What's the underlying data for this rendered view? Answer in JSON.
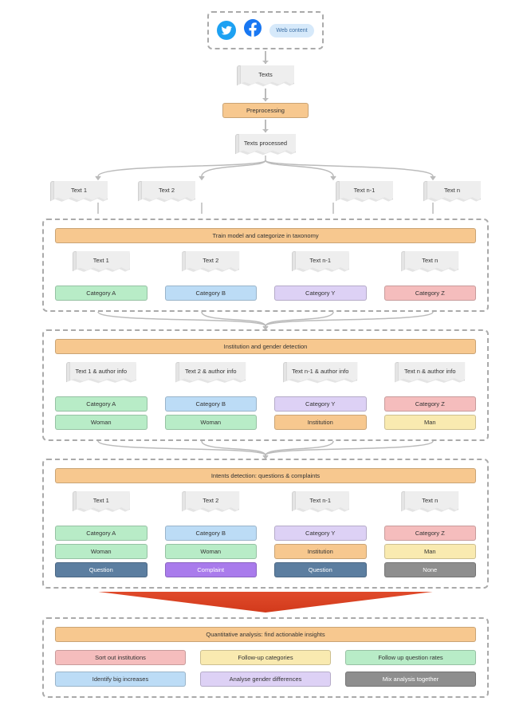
{
  "sources": {
    "twitter": "twitter-icon",
    "facebook": "facebook-icon",
    "web": "Web content"
  },
  "texts": {
    "label": "Texts",
    "processed": "Texts processed"
  },
  "preprocessing": "Preprocessing",
  "split": {
    "t1": "Text 1",
    "t2": "Text 2",
    "tn1": "Text n-1",
    "tn": "Text n"
  },
  "stage1": {
    "title": "Train model and categorize in taxonomy",
    "t1": "Text 1",
    "t2": "Text 2",
    "tn1": "Text n-1",
    "tn": "Text n",
    "c1": "Category A",
    "c2": "Category B",
    "c3": "Category Y",
    "c4": "Category Z"
  },
  "stage2": {
    "title": "Institution and gender detection",
    "t1": "Text 1 & author info",
    "t2": "Text 2 & author info",
    "tn1": "Text n-1 & author info",
    "tn": "Text n & author info",
    "c1": "Category A",
    "c2": "Category B",
    "c3": "Category Y",
    "c4": "Category Z",
    "g1": "Woman",
    "g2": "Woman",
    "g3": "Institution",
    "g4": "Man"
  },
  "stage3": {
    "title": "Intents detection: questions & complaints",
    "t1": "Text 1",
    "t2": "Text 2",
    "tn1": "Text n-1",
    "tn": "Text n",
    "c1": "Category A",
    "c2": "Category B",
    "c3": "Category Y",
    "c4": "Category Z",
    "g1": "Woman",
    "g2": "Woman",
    "g3": "Institution",
    "g4": "Man",
    "i1": "Question",
    "i2": "Complaint",
    "i3": "Question",
    "i4": "None"
  },
  "stage4": {
    "title": "Quantitative analysis: find actionable insights",
    "items": [
      "Sort out institutions",
      "Follow-up categories",
      "Follow up question rates",
      "Identify big increases",
      "Analyse gender differences",
      "Mix analysis together"
    ],
    "colors": [
      "pink",
      "yellow",
      "green",
      "blue",
      "lilac",
      "grayb"
    ]
  }
}
